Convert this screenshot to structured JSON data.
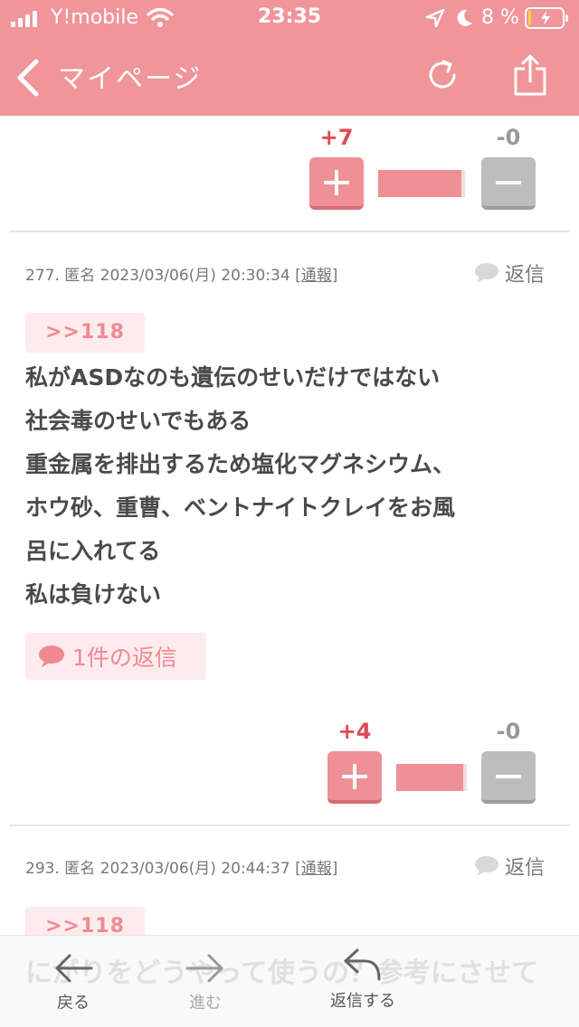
{
  "status_bar": {
    "carrier": "Y!mobile",
    "time": "23:35",
    "battery_percent": "8 %",
    "battery_level": 0.08
  },
  "nav": {
    "title": "マイページ",
    "back_icon": "chevron-left-icon",
    "reload_icon": "reload-icon",
    "share_icon": "share-icon"
  },
  "top_vote": {
    "plus": "+7",
    "minus": "-0",
    "ratio": 0.96
  },
  "posts": [
    {
      "meta": "277. 匿名 2023/03/06(月) 20:30:34",
      "report": "[通報]",
      "reply_label": "返信",
      "anchor": ">>118",
      "lines": [
        "私がASDなのも遺伝のせいだけではない",
        "社会毒のせいでもある",
        "重金属を排出するため塩化マグネシウム、",
        "ホウ砂、重曹、ベントナイトクレイをお風",
        "呂に入れてる",
        "私は負けない"
      ],
      "reply_count": "1件の返信",
      "vote": {
        "plus": "+4",
        "minus": "-0",
        "ratio": 0.95
      }
    },
    {
      "meta": "293. 匿名 2023/03/06(月) 20:44:37",
      "report": "[通報]",
      "reply_label": "返信",
      "anchor": ">>118",
      "lines": [
        "にがりをどうやって使うの？参考にさせて"
      ]
    }
  ],
  "toolbar": {
    "back_label": "戻る",
    "forward_label": "進む",
    "reply_label": "返信する"
  },
  "colors": {
    "brand": "#f0959a",
    "accent": "#ef8f96",
    "plus_count": "#e04a52"
  }
}
